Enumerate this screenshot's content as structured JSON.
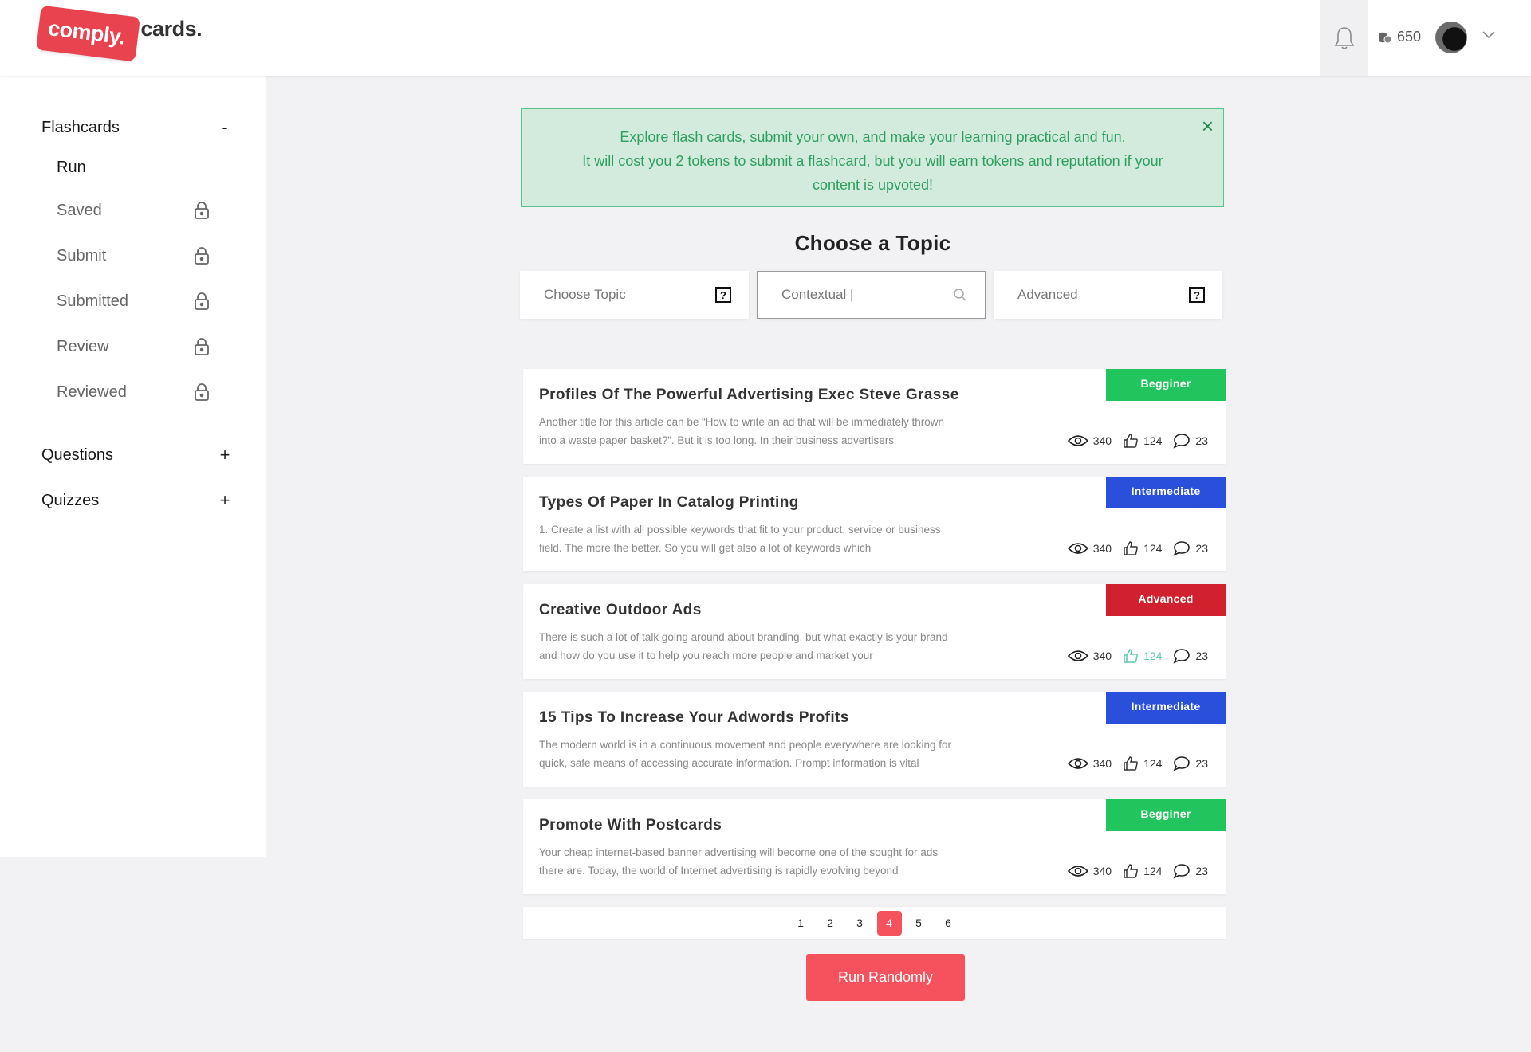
{
  "header": {
    "logo_badge": "comply.",
    "logo_word": "cards.",
    "token_count": "650"
  },
  "sidebar": {
    "flashcards": {
      "label": "Flashcards",
      "toggle": "-"
    },
    "items": [
      {
        "label": "Run"
      },
      {
        "label": "Saved"
      },
      {
        "label": "Submit"
      },
      {
        "label": "Submitted"
      },
      {
        "label": "Review"
      },
      {
        "label": "Reviewed"
      }
    ],
    "questions": {
      "label": "Questions",
      "toggle": "+"
    },
    "quizzes": {
      "label": "Quizzes",
      "toggle": "+"
    }
  },
  "alert": {
    "line1": "Explore flash cards, submit your own, and make your learning practical and fun.",
    "line2": "It will cost you 2 tokens to submit a flashcard, but you will earn tokens and reputation if your content is upvoted!",
    "close": "×"
  },
  "topic_section": {
    "title": "Choose a Topic",
    "filters": {
      "topic": "Choose Topic",
      "search_placeholder": "Contextual |",
      "advanced": "Advanced",
      "help": "?"
    }
  },
  "cards": [
    {
      "title": "Profiles Of The Powerful Advertising Exec Steve Grasse",
      "desc": "Another title for this article can be “How to write an ad that will be immediately thrown into a waste paper basket?”. But it is too long. In their business advertisers",
      "level": "Begginer",
      "color": "#22c45e",
      "views": "340",
      "likes": "124",
      "comments": "23"
    },
    {
      "title": "Types Of Paper In Catalog Printing",
      "desc": "1. Create a list with all possible keywords that fit to your product, service or business field. The more the better. So you will get also a lot of keywords which",
      "level": "Intermediate",
      "color": "#2a50db",
      "views": "340",
      "likes": "124",
      "comments": "23"
    },
    {
      "title": "Creative Outdoor Ads",
      "desc": "There is such a lot of talk going around about branding, but what exactly is your brand and how do you use it to help you reach more people and market your",
      "level": "Advanced",
      "color": "#d2212e",
      "views": "340",
      "likes": "124",
      "comments": "23"
    },
    {
      "title": "15 Tips To Increase Your Adwords Profits",
      "desc": "The modern world is in a continuous movement and people everywhere are looking for quick, safe means of accessing accurate information. Prompt information is vital",
      "level": "Intermediate",
      "color": "#2a50db",
      "views": "340",
      "likes": "124",
      "comments": "23"
    },
    {
      "title": "Promote With Postcards",
      "desc": "Your cheap internet-based banner advertising will become one of the sought for ads there are. Today, the world of Internet advertising is rapidly evolving beyond",
      "level": "Begginer",
      "color": "#22c45e",
      "views": "340",
      "likes": "124",
      "comments": "23"
    }
  ],
  "pagination": {
    "pages": [
      "1",
      "2",
      "3",
      "4",
      "5",
      "6"
    ],
    "current": "4"
  },
  "run_button": "Run Randomly"
}
